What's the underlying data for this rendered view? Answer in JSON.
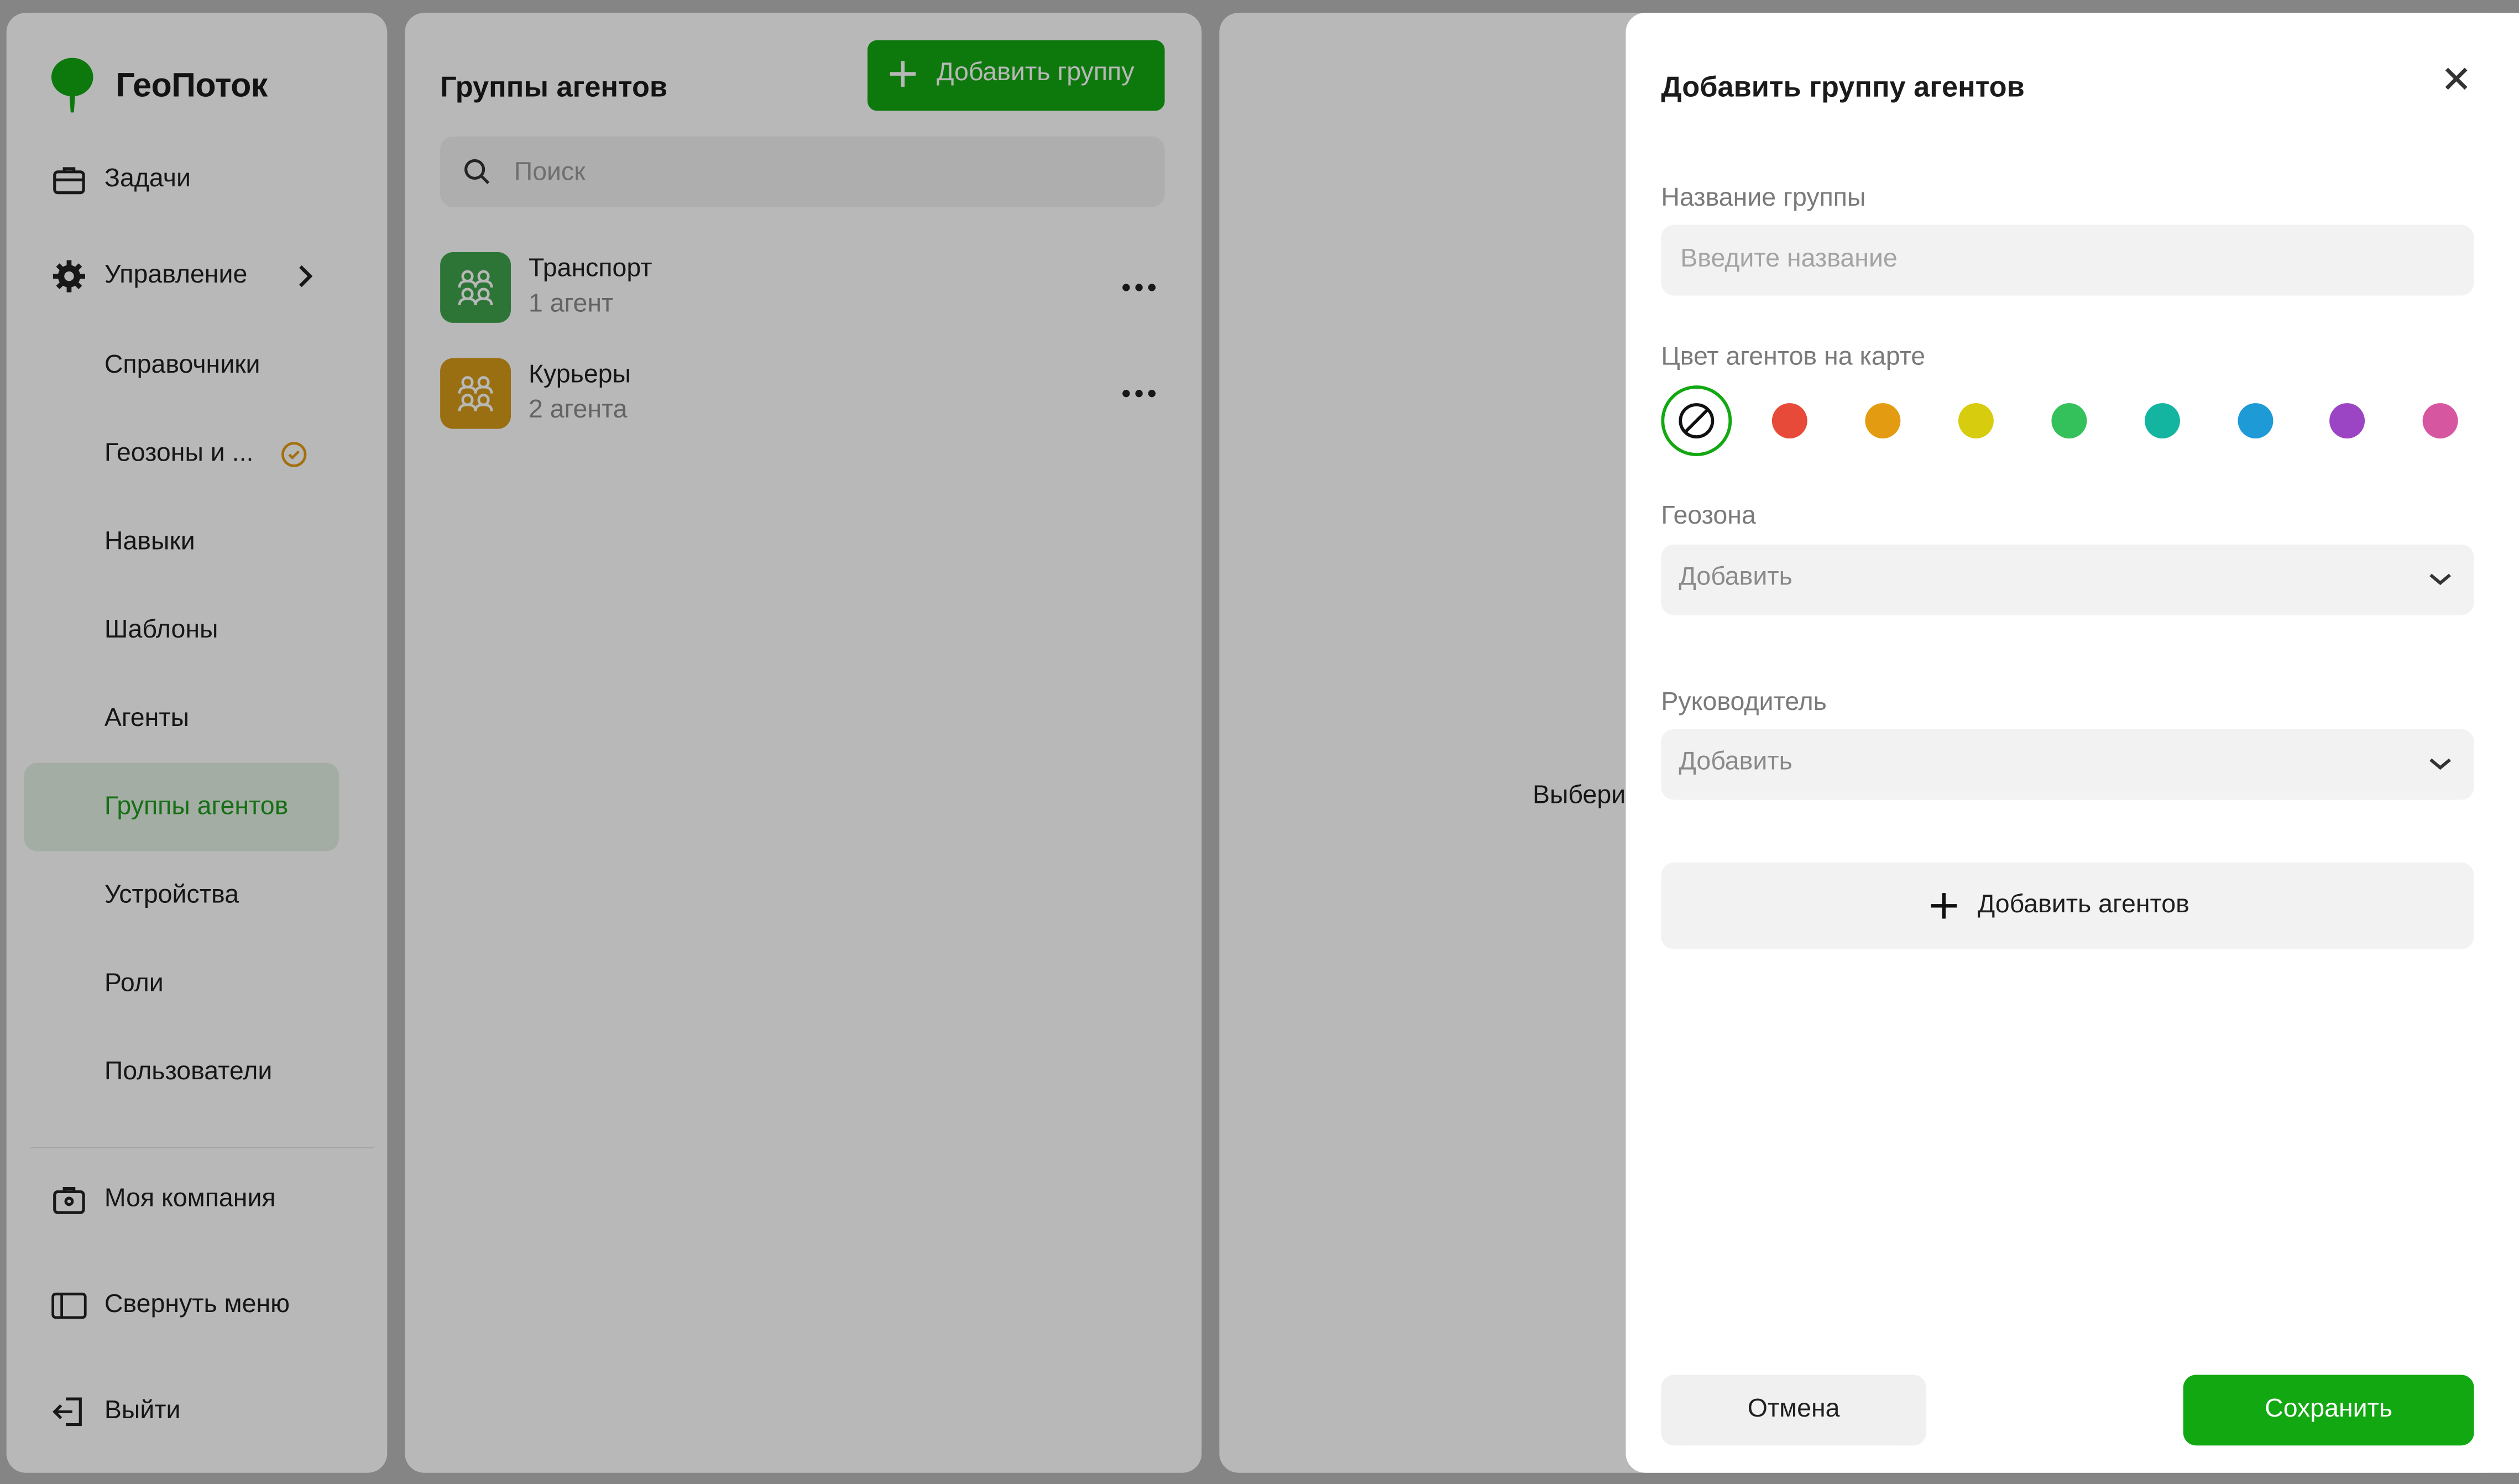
{
  "app": {
    "name": "ГеоПоток",
    "brand_color": "#12a812"
  },
  "sidebar": {
    "items": [
      {
        "label": "Задачи",
        "icon": "briefcase-icon"
      },
      {
        "label": "Управление",
        "icon": "gear-icon",
        "expanded": true
      },
      {
        "label": "Справочники"
      },
      {
        "label": "Геозоны и ...",
        "badge_icon": "clock-icon"
      },
      {
        "label": "Навыки"
      },
      {
        "label": "Шаблоны"
      },
      {
        "label": "Агенты"
      },
      {
        "label": "Группы агентов",
        "active": true
      },
      {
        "label": "Устройства"
      },
      {
        "label": "Роли"
      },
      {
        "label": "Пользователи"
      }
    ],
    "footer": [
      {
        "label": "Моя компания",
        "icon": "company-icon"
      },
      {
        "label": "Свернуть меню",
        "icon": "collapse-menu-icon"
      },
      {
        "label": "Выйти",
        "icon": "logout-icon"
      }
    ]
  },
  "list": {
    "title": "Группы агентов",
    "add_button": "Добавить группу",
    "search_placeholder": "Поиск",
    "groups": [
      {
        "name": "Транспорт",
        "count": "1 агент",
        "color": "#3fa34d"
      },
      {
        "name": "Курьеры",
        "count": "2 агента",
        "color": "#d49a1a"
      }
    ]
  },
  "detail": {
    "placeholder_text": "Выбери"
  },
  "dialog": {
    "title": "Добавить группу агентов",
    "name_label": "Название группы",
    "name_placeholder": "Введите название",
    "color_label": "Цвет агентов на карте",
    "colors": [
      "none",
      "#e84a3a",
      "#e39b12",
      "#d8cc0e",
      "#34c15b",
      "#13b5a0",
      "#1e9ad6",
      "#9b45c4",
      "#d6569f"
    ],
    "selected_color": "none",
    "geozone_label": "Геозона",
    "geozone_value": "Добавить",
    "manager_label": "Руководитель",
    "manager_value": "Добавить",
    "add_agents_button": "Добавить агентов",
    "cancel_button": "Отмена",
    "save_button": "Сохранить"
  }
}
